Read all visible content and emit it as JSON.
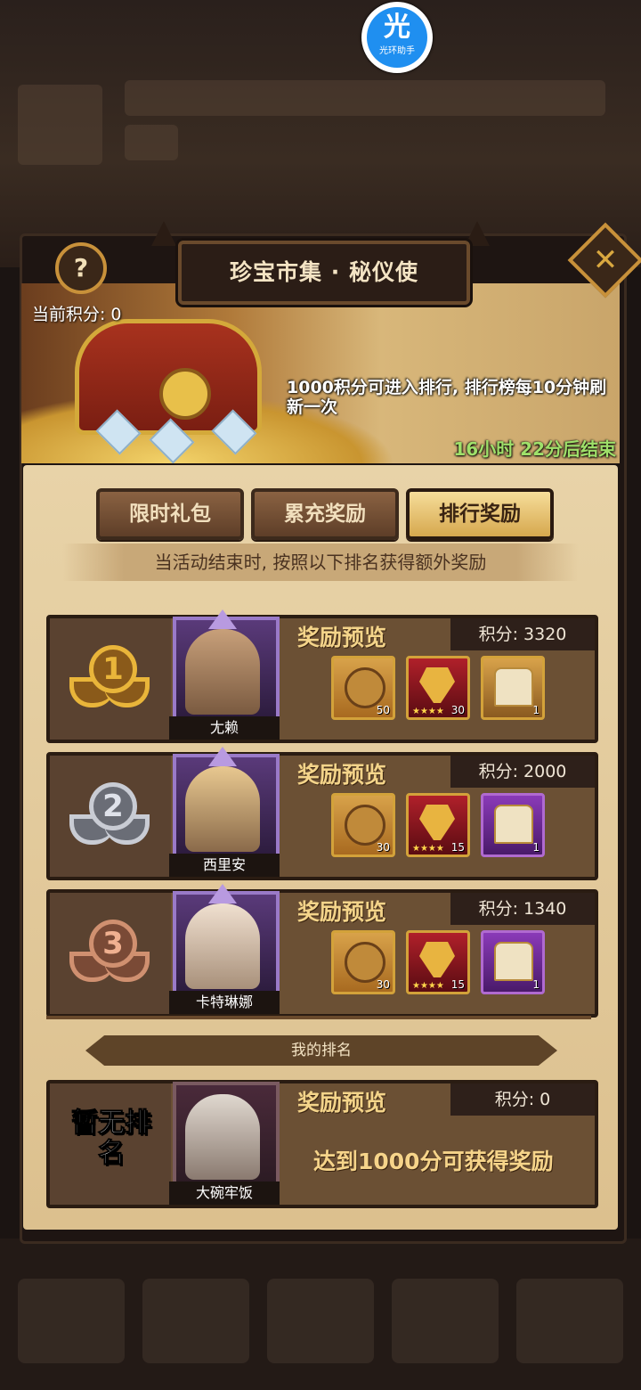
{
  "helper_badge": {
    "glyph": "光",
    "label": "光环助手"
  },
  "title": "珍宝市集 · 秘仪使",
  "help_icon": "?",
  "close_icon": "✕",
  "current_score": {
    "label": "当前积分:",
    "value": "0"
  },
  "rule_text": "1000积分可进入排行, 排行榜每10分钟刷新一次",
  "timer": "16小时 22分后结束",
  "tabs": [
    {
      "label": "限时礼包",
      "active": false
    },
    {
      "label": "累充奖励",
      "active": false
    },
    {
      "label": "排行奖励",
      "active": true
    }
  ],
  "subtitle": "当活动结束时, 按照以下排名获得额外奖励",
  "ranks": [
    {
      "rank": "1",
      "name": "尢赖",
      "preview_label": "奖励预览",
      "points": "积分: 3320",
      "items": [
        {
          "icon": "scroll-icon",
          "count": "50",
          "stars": ""
        },
        {
          "icon": "hero-fragment-icon",
          "count": "30",
          "stars": "★★★★"
        },
        {
          "icon": "chest-icon",
          "count": "1",
          "stars": ""
        }
      ]
    },
    {
      "rank": "2",
      "name": "西里安",
      "preview_label": "奖励预览",
      "points": "积分: 2000",
      "items": [
        {
          "icon": "scroll-icon",
          "count": "30",
          "stars": ""
        },
        {
          "icon": "hero-fragment-icon",
          "count": "15",
          "stars": "★★★★"
        },
        {
          "icon": "chest-icon",
          "count": "1",
          "stars": ""
        }
      ]
    },
    {
      "rank": "3",
      "name": "卡特琳娜",
      "preview_label": "奖励预览",
      "points": "积分: 1340",
      "items": [
        {
          "icon": "scroll-icon",
          "count": "30",
          "stars": ""
        },
        {
          "icon": "hero-fragment-icon",
          "count": "15",
          "stars": "★★★★"
        },
        {
          "icon": "chest-icon",
          "count": "1",
          "stars": ""
        }
      ]
    }
  ],
  "my_rank": {
    "header": "我的排名",
    "status": "暂无排名",
    "name": "大碗牢饭",
    "preview_label": "奖励预览",
    "points": "积分: 0",
    "hint": "达到1000分可获得奖励"
  }
}
